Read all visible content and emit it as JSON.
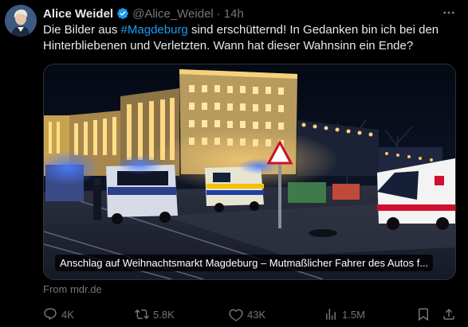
{
  "author": {
    "name": "Alice Weidel",
    "handle": "@Alice_Weidel",
    "separator": "·",
    "time": "14h",
    "verified_icon": "verified-badge-icon"
  },
  "tweet": {
    "text_before": "Die Bilder aus ",
    "hashtag": "#Magdeburg",
    "text_after": " sind erschütternd! In Gedanken bin ich bei den Hinterbliebenen und Verletzten. Wann hat dieser Wahnsinn ein Ende?"
  },
  "card": {
    "caption": "Anschlag auf Weihnachtsmarkt Magdeburg – Mutmaßlicher Fahrer des Autos f...",
    "source": "From mdr.de"
  },
  "actions": {
    "replies": "4K",
    "reposts": "5.8K",
    "likes": "43K",
    "views": "1.5M"
  },
  "colors": {
    "background": "#000000",
    "text": "#e7e9ea",
    "muted": "#71767b",
    "accent": "#1d9bf0"
  }
}
